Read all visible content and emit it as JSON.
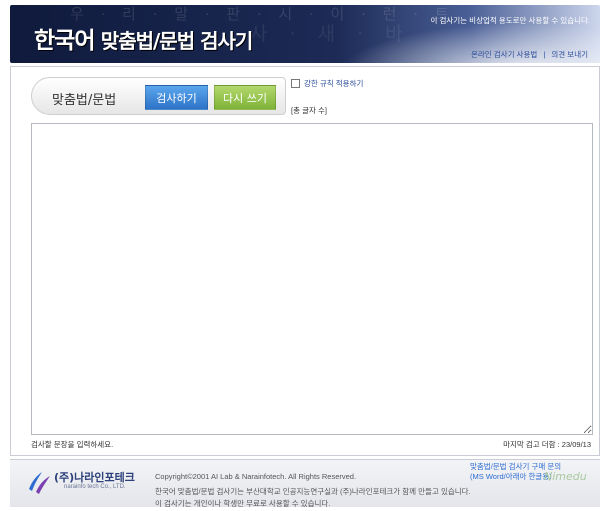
{
  "header": {
    "bg_letters_1": "우 · 리 · 말 · 판 · 시 · 이 · 런 · 트",
    "bg_letters_2": "사 · 새 · 바",
    "title_part1": "한국어",
    "title_part2": "맞춤법/문법 검사기",
    "notice": "이 검사기는 비상업적 용도로만 사용할 수 있습니다.",
    "link_usage": "온라인 검사기 사용법",
    "separator": "|",
    "link_feedback": "의견 보내기"
  },
  "main": {
    "mode_label": "맞춤법/문법",
    "check_button": "검사하기",
    "reset_button": "다시 쓰기",
    "strict_label": "강한 규칙 적용하기",
    "char_count": "[총 글자 수]",
    "input_value": "",
    "input_placeholder": "",
    "hint": "검사할 문장을 입력하세요.",
    "last_update": "마지막 검고 더함 : 23/09/13"
  },
  "footer": {
    "company": "(주)나라인포테크",
    "company_en": "narainfo tech Co., LTD.",
    "copyright": "Copyright©2001 AI Lab & Narainfotech. All Rights Reserved.",
    "about_line1": "한국어 맞춤법/문법 검사기는 부산대학교 인공지능연구실과 (주)나라인포테크가 함께 만들고 있습니다.",
    "about_line2": "이 검사기는 개인이나 학생만 무료로 사용할 수 있습니다.",
    "purchase_line1": "맞춤법/문법 검사기 구매 문의",
    "purchase_line2": "(MS Word/아래아 한글용)",
    "watermark": "Nimedu"
  },
  "colors": {
    "header_dark": "#0f1a3c",
    "link_blue": "#2b4c9a",
    "check_button": "#3d86d6",
    "reset_button": "#8fc24a"
  }
}
